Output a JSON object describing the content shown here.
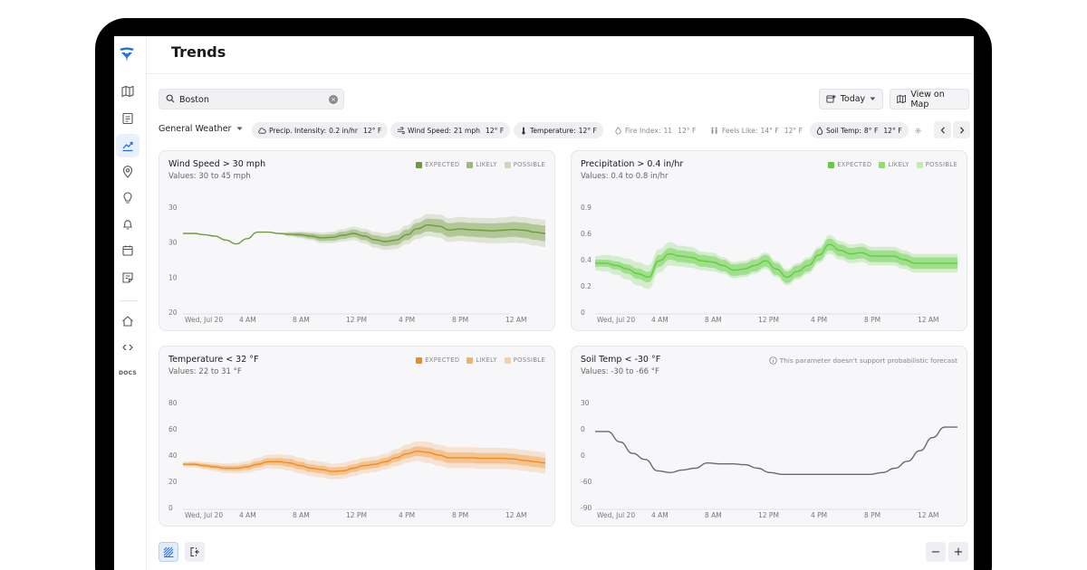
{
  "page": {
    "title": "Trends"
  },
  "sidebar": {
    "docs_label": "DOCS"
  },
  "search": {
    "value": "Boston",
    "placeholder": ""
  },
  "toolbar": {
    "today_label": "Today",
    "map_label": "View on Map"
  },
  "filter": {
    "group_label": "General Weather",
    "chips": [
      {
        "name": "Precip. Intensity:",
        "value": "0.2 in/hr",
        "temp": "12° F",
        "icon": "precip-intensity-icon",
        "active": true
      },
      {
        "name": "Wind Speed:",
        "value": "21 mph",
        "temp": "12° F",
        "icon": "wind-icon",
        "active": true
      },
      {
        "name": "Temperature:",
        "value": "12° F",
        "temp": "",
        "icon": "thermometer-icon",
        "active": true
      },
      {
        "name": "Fire Index:",
        "value": "11",
        "temp": "12° F",
        "icon": "fire-icon",
        "active": false
      },
      {
        "name": "Feels Like:",
        "value": "14° F",
        "temp": "12° F",
        "icon": "feels-like-icon",
        "active": false
      },
      {
        "name": "Soil Temp:",
        "value": "8° F",
        "temp": "12° F",
        "icon": "soil-drop-icon",
        "active": true
      }
    ]
  },
  "legend": {
    "expected": "EXPECTED",
    "likely": "LIKELY",
    "possible": "POSSIBLE"
  },
  "x_labels": [
    "Wed, Jul 20",
    "4 AM",
    "8 AM",
    "12 PM",
    "4 PM",
    "8 PM",
    "12 AM"
  ],
  "panels": [
    {
      "title": "Wind Speed > 30 mph",
      "subtitle": "Values: 30 to 45 mph",
      "color": "#6e9a3a"
    },
    {
      "title": "Precipitation  > 0.4 in/hr",
      "subtitle": "Values: 0.4 to 0.8 in/hr",
      "color": "#5fcf3c"
    },
    {
      "title": "Temperature < 32 °F",
      "subtitle": "Values: 22 to 31 °F",
      "color": "#f08c1e"
    },
    {
      "title": "Soil Temp < -30 °F",
      "subtitle": "Values: -30 to -66 °F",
      "color": "#6a6a72",
      "note": "This parameter doesn't support probabilistic forecast"
    }
  ],
  "chart_data": [
    {
      "type": "area",
      "title": "Wind Speed > 30 mph",
      "x": [
        "Wed, Jul 20",
        "4 AM",
        "8 AM",
        "12 PM",
        "4 PM",
        "8 PM",
        "12 AM"
      ],
      "yticks": [
        "30",
        "30",
        "10",
        "20"
      ],
      "ylim": [
        0,
        40
      ],
      "series": [
        {
          "name": "EXPECTED",
          "values": [
            30,
            30,
            29.5,
            29,
            27.5,
            26,
            28,
            30.5,
            30.5,
            30,
            29.7,
            29.5,
            29,
            28.3,
            28.5,
            29.3,
            30,
            29,
            27.6,
            26.9,
            27.5,
            29.5,
            31.8,
            33.2,
            32.8,
            31.3,
            31.7,
            31.4,
            31.2,
            31,
            31.2,
            31.5,
            31.2,
            30.5,
            30
          ]
        },
        {
          "name": "LIKELY",
          "band": true,
          "offsets": [
            0,
            0,
            0,
            0,
            0,
            0,
            0,
            0,
            0,
            0,
            0.5,
            0.8,
            1,
            1.2,
            1.3,
            1.4,
            1.5,
            1.6,
            1.7,
            1.8,
            1.9,
            2,
            2.2,
            2.4,
            2.6,
            2.6,
            2.6,
            2.6,
            2.7,
            2.8,
            2.8,
            2.8,
            2.9,
            2.9,
            3
          ]
        },
        {
          "name": "POSSIBLE",
          "band": true,
          "offsets": [
            0,
            0,
            0,
            0,
            0,
            0,
            0,
            0,
            0,
            0,
            0.9,
            1.3,
            1.6,
            2,
            2.2,
            2.4,
            2.6,
            2.8,
            3,
            3.2,
            3.4,
            3.6,
            3.9,
            4.2,
            4.4,
            4.5,
            4.6,
            4.6,
            4.7,
            4.8,
            4.9,
            5,
            5,
            5.1,
            5.2
          ]
        }
      ]
    },
    {
      "type": "area",
      "title": "Precipitation  > 0.4 in/hr",
      "x": [
        "Wed, Jul 20",
        "4 AM",
        "8 AM",
        "12 PM",
        "4 PM",
        "8 PM",
        "12 AM"
      ],
      "yticks": [
        "0.9",
        "0.6",
        "0.4",
        "0.2",
        "0"
      ],
      "ylim": [
        0,
        0.9
      ],
      "series": [
        {
          "name": "EXPECTED",
          "values": [
            0.42,
            0.42,
            0.4,
            0.37,
            0.33,
            0.3,
            0.44,
            0.5,
            0.48,
            0.47,
            0.44,
            0.43,
            0.4,
            0.36,
            0.37,
            0.4,
            0.44,
            0.37,
            0.3,
            0.35,
            0.4,
            0.49,
            0.58,
            0.53,
            0.5,
            0.51,
            0.48,
            0.48,
            0.48,
            0.45,
            0.42,
            0.42,
            0.42,
            0.42,
            0.42
          ]
        },
        {
          "name": "LIKELY",
          "band": true,
          "offsets": [
            0.03,
            0.03,
            0.035,
            0.04,
            0.045,
            0.045,
            0.05,
            0.05,
            0.05,
            0.05,
            0.05,
            0.05,
            0.05,
            0.05,
            0.05,
            0.05,
            0.05,
            0.05,
            0.05,
            0.05,
            0.05,
            0.05,
            0.05,
            0.05,
            0.05,
            0.05,
            0.05,
            0.05,
            0.05,
            0.05,
            0.05,
            0.05,
            0.05,
            0.05,
            0.05
          ]
        },
        {
          "name": "POSSIBLE",
          "band": true,
          "offsets": [
            0.06,
            0.07,
            0.08,
            0.09,
            0.1,
            0.1,
            0.1,
            0.1,
            0.09,
            0.09,
            0.08,
            0.08,
            0.07,
            0.07,
            0.07,
            0.07,
            0.07,
            0.07,
            0.07,
            0.07,
            0.07,
            0.07,
            0.08,
            0.08,
            0.08,
            0.08,
            0.08,
            0.08,
            0.08,
            0.08,
            0.08,
            0.08,
            0.08,
            0.08,
            0.08
          ]
        }
      ]
    },
    {
      "type": "area",
      "title": "Temperature < 32 °F",
      "x": [
        "Wed, Jul 20",
        "4 AM",
        "8 AM",
        "12 PM",
        "4 PM",
        "8 PM",
        "12 AM"
      ],
      "yticks": [
        "80",
        "60",
        "40",
        "20",
        "0"
      ],
      "ylim": [
        0,
        80
      ],
      "series": [
        {
          "name": "EXPECTED",
          "values": [
            33,
            33,
            32,
            31,
            30,
            30,
            31,
            33,
            35,
            35,
            34,
            32,
            30,
            29,
            27.5,
            28,
            30,
            32,
            33,
            35,
            38,
            41,
            43,
            42,
            40,
            38,
            38,
            38,
            37.5,
            37.5,
            37.5,
            37,
            36,
            35,
            34
          ]
        },
        {
          "name": "LIKELY",
          "band": true,
          "offsets": [
            1,
            1.2,
            1.4,
            1.6,
            1.8,
            2,
            2.2,
            2.4,
            2.6,
            2.8,
            3,
            3,
            3,
            3,
            3,
            3,
            3,
            3,
            3,
            3,
            3.2,
            3.4,
            3.6,
            3.8,
            4,
            4,
            4,
            4,
            4,
            4,
            4,
            4,
            4,
            4,
            4
          ]
        },
        {
          "name": "POSSIBLE",
          "band": true,
          "offsets": [
            2,
            2.4,
            2.8,
            3.2,
            3.6,
            4,
            4.4,
            4.8,
            5.2,
            5.6,
            6,
            6,
            6,
            6,
            6,
            6,
            6,
            6,
            6,
            6,
            6.5,
            7,
            7.5,
            8,
            8,
            8,
            8,
            8,
            8,
            8,
            8,
            8,
            8,
            8,
            8
          ]
        }
      ]
    },
    {
      "type": "line",
      "title": "Soil Temp < -30 °F",
      "x": [
        "Wed, Jul 20",
        "4 AM",
        "8 AM",
        "12 PM",
        "4 PM",
        "8 PM",
        "12 AM"
      ],
      "yticks": [
        "30",
        "0",
        "0",
        "-60",
        "-90"
      ],
      "ylim": [
        -90,
        30
      ],
      "series": [
        {
          "name": "EXPECTED",
          "values": [
            -3,
            -3,
            -15,
            -28,
            -35,
            -48,
            -50,
            -47,
            -45,
            -39,
            -40,
            -40,
            -41,
            -45,
            -50,
            -52,
            -52,
            -52,
            -52,
            -52,
            -52,
            -52,
            -52,
            -50,
            -45,
            -37,
            -25,
            -10,
            2,
            2
          ]
        }
      ]
    }
  ]
}
